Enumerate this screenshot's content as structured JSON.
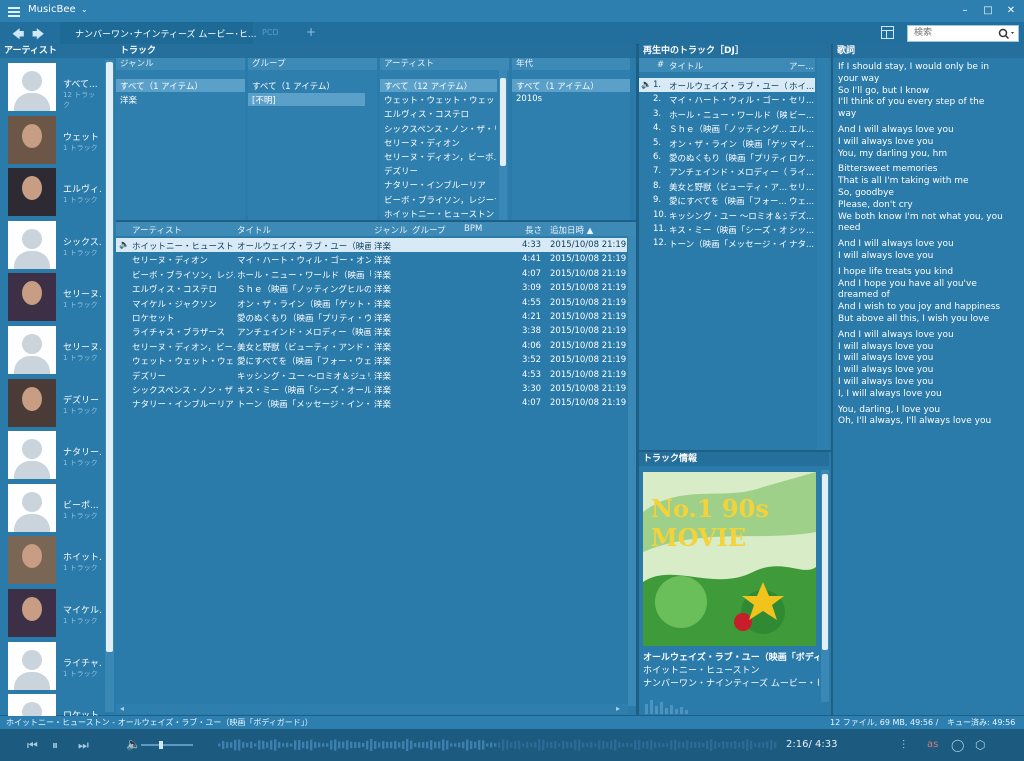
{
  "app": {
    "title": "MusicBee",
    "caret": "⌄"
  },
  "window": {
    "minimize": "–",
    "maximize": "□",
    "close": "✕"
  },
  "toolbar": {
    "back": "🡄",
    "forward": "🡆",
    "tab_active": "ナンバーワン･ナインティーズ  ムービー･ヒ...",
    "tab_inactive": "PCD",
    "tab_add": "+",
    "search_placeholder": "検索"
  },
  "panes": {
    "artist": "アーティスト",
    "tracks": "トラック",
    "now_playing": "再生中のトラック［DJ］",
    "lyrics": "歌詞",
    "track_info": "トラック情報"
  },
  "artists": [
    {
      "name": "すべて...",
      "count": "12 トラック",
      "photo": false
    },
    {
      "name": "ウェット・...",
      "count": "1 トラック",
      "photo": true
    },
    {
      "name": "エルヴィ...",
      "count": "1 トラック",
      "photo": true
    },
    {
      "name": "シックス...",
      "count": "1 トラック",
      "photo": false
    },
    {
      "name": "セリーヌ...",
      "count": "1 トラック",
      "photo": true
    },
    {
      "name": "セリーヌ...",
      "count": "1 トラック",
      "photo": false
    },
    {
      "name": "デズリー",
      "count": "1 トラック",
      "photo": true
    },
    {
      "name": "ナタリー...",
      "count": "1 トラック",
      "photo": false
    },
    {
      "name": "ビーボ...",
      "count": "1 トラック",
      "photo": false
    },
    {
      "name": "ホイット...",
      "count": "1 トラック",
      "photo": true
    },
    {
      "name": "マイケル...",
      "count": "1 トラック",
      "photo": true
    },
    {
      "name": "ライチャ...",
      "count": "1 トラック",
      "photo": false
    },
    {
      "name": "ロケット",
      "count": "",
      "photo": false
    }
  ],
  "filters": {
    "genre": {
      "header": "ジャンル",
      "items": [
        "すべて（1 アイテム）",
        "洋楽"
      ]
    },
    "grouping": {
      "header": "グループ",
      "items": [
        "すべて（1 アイテム）",
        "[不明]"
      ]
    },
    "artist": {
      "header": "アーティスト",
      "items": [
        "すべて（12 アイテム）",
        "ウェット・ウェット・ウェット",
        "エルヴィス・コステロ",
        "シックスペンス・ノン・ザ・リッチ...",
        "セリーヌ・ディオン",
        "セリーヌ・ディオン，ビーボ...",
        "デズリー",
        "ナタリー・インブルーリア",
        "ビーボ・ブライソン，レジーナ...",
        "ホイットニー・ヒューストン"
      ]
    },
    "year": {
      "header": "年代",
      "items": [
        "すべて（1 アイテム）",
        "2010s"
      ]
    }
  },
  "tracklist": {
    "headers": {
      "artist": "アーティスト",
      "title": "タイトル",
      "genre": "ジャンル",
      "group": "グループ",
      "bpm": "BPM",
      "length": "長さ",
      "added": "追加日時 ▲"
    },
    "rows": [
      {
        "artist": "ホイットニー・ヒューストン",
        "title": "オールウェイズ・ラブ・ユー（映画「ボ...",
        "genre": "洋楽",
        "length": "4:33",
        "added": "2015/10/08 21:19",
        "playing": true
      },
      {
        "artist": "セリーヌ・ディオン",
        "title": "マイ・ハート・ウィル・ゴー・オン（映...",
        "genre": "洋楽",
        "length": "4:41",
        "added": "2015/10/08 21:19",
        "playing": false
      },
      {
        "artist": "ビーボ・ブライソン，レジ...",
        "title": "ホール・ニュー・ワールド（映画「ア...",
        "genre": "洋楽",
        "length": "4:07",
        "added": "2015/10/08 21:19",
        "playing": false
      },
      {
        "artist": "エルヴィス・コステロ",
        "title": "Ｓｈｅ（映画「ノッティングヒルの...",
        "genre": "洋楽",
        "length": "3:09",
        "added": "2015/10/08 21:19",
        "playing": false
      },
      {
        "artist": "マイケル・ジャクソン",
        "title": "オン・ザ・ライン（映画「ゲット・オ...",
        "genre": "洋楽",
        "length": "4:55",
        "added": "2015/10/08 21:19",
        "playing": false
      },
      {
        "artist": "ロケセット",
        "title": "愛のぬくもり（映画「プリティ・ウー...",
        "genre": "洋楽",
        "length": "4:21",
        "added": "2015/10/08 21:19",
        "playing": false
      },
      {
        "artist": "ライチャス・ブラザース",
        "title": "アンチェインド・メロディー（映画「...",
        "genre": "洋楽",
        "length": "3:38",
        "added": "2015/10/08 21:19",
        "playing": false
      },
      {
        "artist": "セリーヌ・ディオン，ビー...",
        "title": "美女と野獣（ビューティ・アンド・...",
        "genre": "洋楽",
        "length": "4:06",
        "added": "2015/10/08 21:19",
        "playing": false
      },
      {
        "artist": "ウェット・ウェット・ウェット",
        "title": "愛にすべてを（映画「フォー・ウェ...",
        "genre": "洋楽",
        "length": "3:52",
        "added": "2015/10/08 21:19",
        "playing": false
      },
      {
        "artist": "デズリー",
        "title": "キッシング・ユー ～ロミオ＆ジュリエ...",
        "genre": "洋楽",
        "length": "4:53",
        "added": "2015/10/08 21:19",
        "playing": false
      },
      {
        "artist": "シックスペンス・ノン・ザ・リ...",
        "title": "キス・ミー（映画「シーズ・オール・...",
        "genre": "洋楽",
        "length": "3:30",
        "added": "2015/10/08 21:19",
        "playing": false
      },
      {
        "artist": "ナタリー・インブルーリア",
        "title": "トーン（映画「メッセージ・イン・ア...",
        "genre": "洋楽",
        "length": "4:07",
        "added": "2015/10/08 21:19",
        "playing": false
      }
    ]
  },
  "queue": {
    "headers": {
      "num": "#",
      "title": "タイトル",
      "artist": "アー..."
    },
    "items": [
      {
        "num": "1.",
        "title": "オールウェイズ・ラブ・ユー（...",
        "artist": "ホイ...",
        "playing": true
      },
      {
        "num": "2.",
        "title": "マイ・ハート・ウィル・ゴー・オン...",
        "artist": "セリ...",
        "playing": false
      },
      {
        "num": "3.",
        "title": "ホール・ニュー・ワールド（映...",
        "artist": "ビー...",
        "playing": false
      },
      {
        "num": "4.",
        "title": "Ｓｈｅ（映画「ノッティング...",
        "artist": "エル...",
        "playing": false
      },
      {
        "num": "5.",
        "title": "オン・ザ・ライン（映画「ゲット...",
        "artist": "マイ...",
        "playing": false
      },
      {
        "num": "6.",
        "title": "愛のぬくもり（映画「プリティ...",
        "artist": "ロケ...",
        "playing": false
      },
      {
        "num": "7.",
        "title": "アンチェインド・メロディー（...",
        "artist": "ライ...",
        "playing": false
      },
      {
        "num": "8.",
        "title": "美女と野獣（ビューティ・ア...",
        "artist": "セリ...",
        "playing": false
      },
      {
        "num": "9.",
        "title": "愛にすべてを（映画「フォー...",
        "artist": "ウェ...",
        "playing": false
      },
      {
        "num": "10.",
        "title": "キッシング・ユー ～ロミオ＆ジ...",
        "artist": "デズ...",
        "playing": false
      },
      {
        "num": "11.",
        "title": "キス・ミー（映画「シーズ・オ...",
        "artist": "シッ...",
        "playing": false
      },
      {
        "num": "12.",
        "title": "トーン（映画「メッセージ・イ...",
        "artist": "ナタ...",
        "playing": false
      }
    ]
  },
  "track_info": {
    "cover_text": "No.1 90s MOVIE",
    "title": "オールウェイズ・ラブ・ユー（映画「ボディガー...",
    "artist": "ホイットニー・ヒューストン",
    "album": "ナンバーワン・ナインティーズ  ムービー・ヒッツ D..."
  },
  "lyrics": [
    "If I should stay, I would only be in",
    "your way",
    "So I'll go, but I know",
    "I'll think of you every step of the",
    "way",
    "",
    "And I will always love you",
    "I will always love you",
    "You, my darling you, hm",
    "",
    "Bittersweet memories",
    "That is all I'm taking with me",
    "So, goodbye",
    "Please, don't cry",
    "We both know I'm not what you, you",
    "need",
    "",
    "And I will always love you",
    "I will always love you",
    "",
    "I hope life treats you kind",
    "And I hope you have all you've",
    "dreamed of",
    "And I wish to you joy and happiness",
    "But above all this, I wish you love",
    "",
    "And I will always love you",
    "I will always love you",
    "I will always love you",
    "I will always love you",
    "I will always love you",
    "I, I will always love you",
    "",
    "You, darling, I love you",
    "Oh, I'll always, I'll always love you"
  ],
  "status": {
    "left": "ホイットニー・ヒューストン - オールウェイズ・ラブ・ユー（映画「ボディガード」）",
    "files": "12 ファイル, 69 MB, 49:56 /",
    "queue": "キュー済み: 49:56"
  },
  "player": {
    "prev": "⏮",
    "pause": "⏸",
    "next": "⏭",
    "volume": "🔈",
    "time": "2:16/ 4:33",
    "eq": "⫶",
    "scrobble": "as",
    "loop": "◯",
    "share": "⬡",
    "progress": 0.5
  }
}
